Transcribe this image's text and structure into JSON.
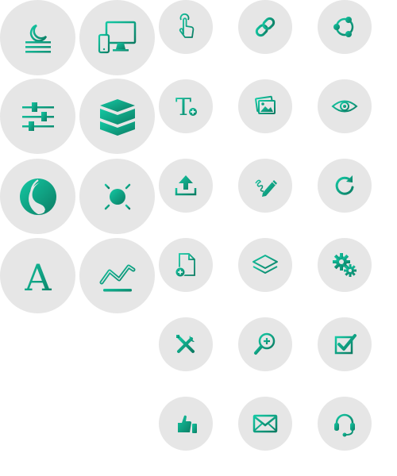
{
  "colors": {
    "circle_background": "#e6e6e6",
    "icon_gradient_light": "#14c9a4",
    "icon_gradient_dark": "#0c7c63"
  },
  "icons": {
    "large": [
      "night-mode-icon",
      "devices-icon",
      "sliders-icon",
      "layers-stack-icon",
      "contrast-icon",
      "brightness-icon",
      "font-icon",
      "trend-line-icon"
    ],
    "small": [
      "touch-icon",
      "link-icon",
      "network-icon",
      "add-text-icon",
      "images-icon",
      "eye-icon",
      "upload-icon",
      "draw-icon",
      "refresh-icon",
      "add-file-icon",
      "layers-icon",
      "gears-icon",
      "tools-icon",
      "zoom-in-icon",
      "checkbox-icon",
      "thumbs-up-icon",
      "mail-icon",
      "headset-icon"
    ]
  },
  "font_icon_glyph": "A",
  "text_icon_glyph": "T"
}
